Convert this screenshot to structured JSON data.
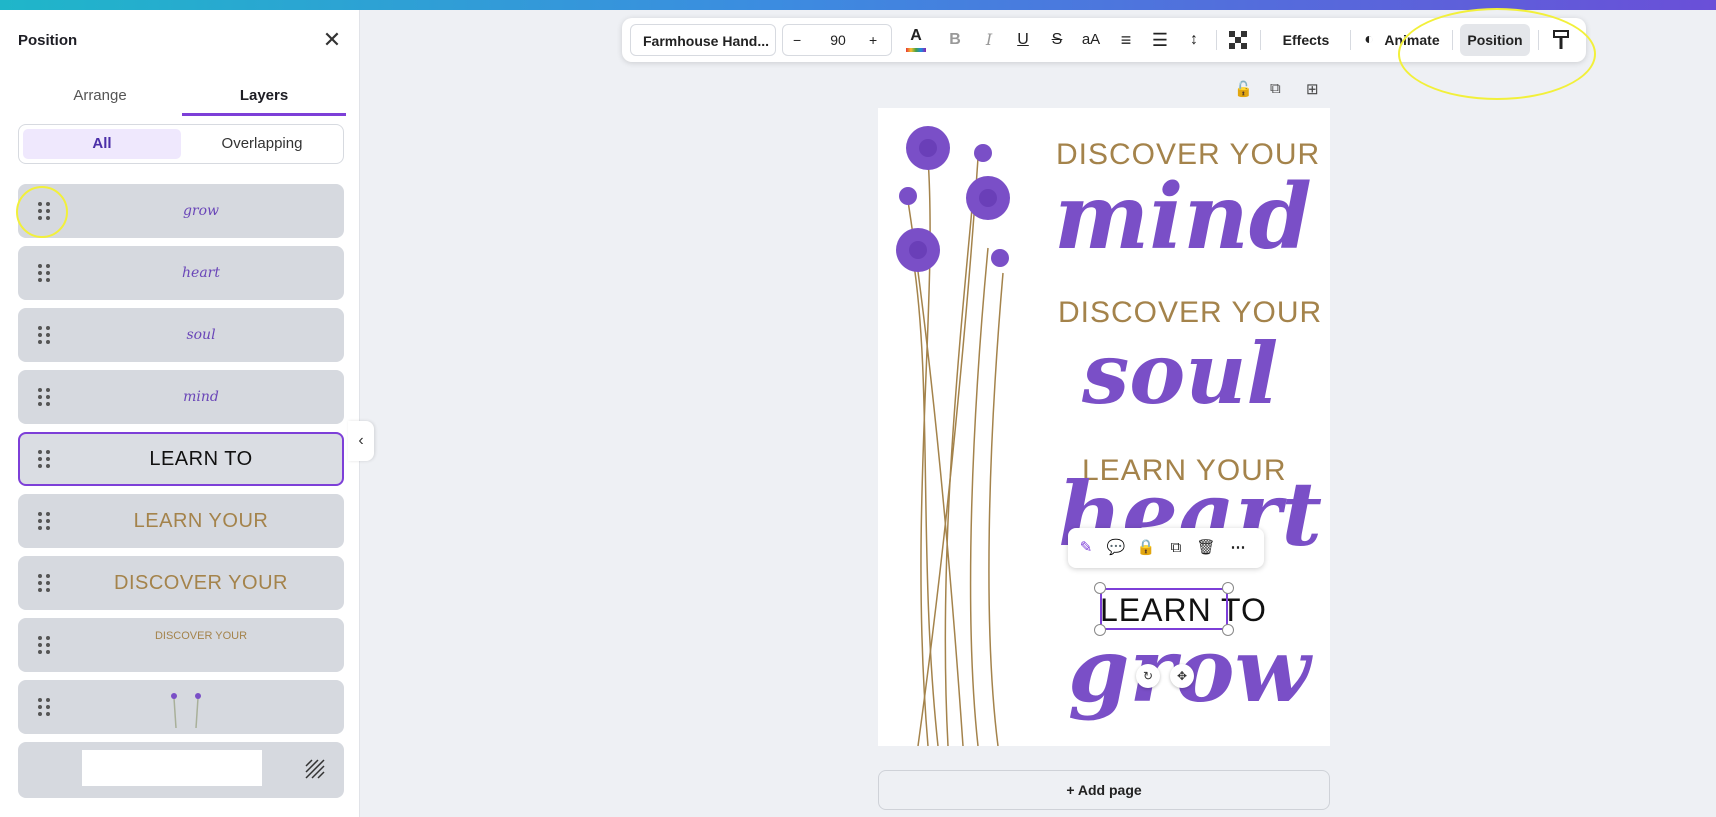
{
  "panel": {
    "title": "Position",
    "close_icon": "close-icon",
    "tabs": [
      {
        "label": "Arrange",
        "active": false
      },
      {
        "label": "Layers",
        "active": true
      }
    ],
    "filter": [
      {
        "label": "All",
        "active": true
      },
      {
        "label": "Overlapping",
        "active": false
      }
    ],
    "layers": [
      {
        "label": "grow",
        "style": "script"
      },
      {
        "label": "heart",
        "style": "script"
      },
      {
        "label": "soul",
        "style": "script"
      },
      {
        "label": "mind",
        "style": "script"
      },
      {
        "label": "LEARN TO",
        "style": "black",
        "selected": true
      },
      {
        "label": "LEARN YOUR",
        "style": "gold"
      },
      {
        "label": "DISCOVER YOUR",
        "style": "gold"
      },
      {
        "label": "DISCOVER YOUR",
        "style": "gold-small"
      },
      {
        "label": "",
        "style": "flowers"
      },
      {
        "label": "",
        "style": "background"
      }
    ]
  },
  "toolbar": {
    "font_name": "Farmhouse Hand...",
    "font_size": "90",
    "minus": "−",
    "plus": "+",
    "effects_label": "Effects",
    "animate_label": "Animate",
    "position_label": "Position"
  },
  "canvas": {
    "line1": "DISCOVER YOUR",
    "word1": "mind",
    "line2": "DISCOVER YOUR",
    "word2": "soul",
    "line3": "LEARN YOUR",
    "word3": "heart",
    "line4": "LEARN TO",
    "word4": "grow",
    "colors": {
      "gold": "#a4834b",
      "purple": "#7a4fc7"
    }
  },
  "add_page_label": "Add page",
  "add_page_icon": "plus-icon"
}
